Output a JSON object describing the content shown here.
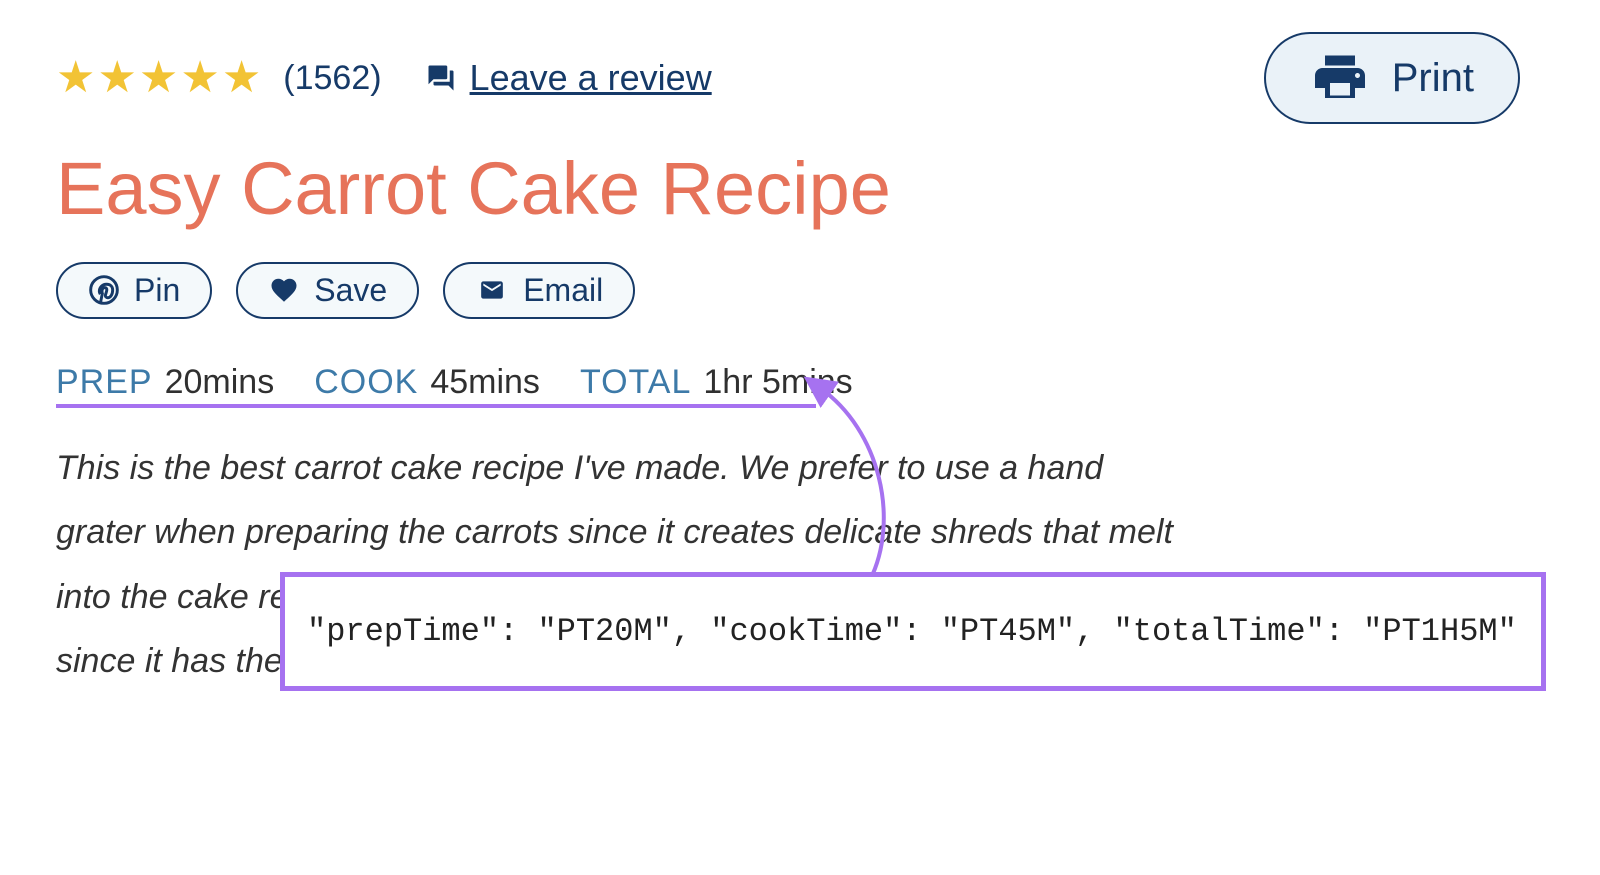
{
  "header": {
    "rating_count": "(1562)",
    "review_link": "Leave a review",
    "print_label": "Print"
  },
  "title": "Easy Carrot Cake Recipe",
  "actions": {
    "pin": "Pin",
    "save": "Save",
    "email": "Email"
  },
  "times": {
    "prep_label": "PREP",
    "prep_value": "20mins",
    "cook_label": "COOK",
    "cook_value": "45mins",
    "total_label": "TOTAL",
    "total_value": "1hr 5mins"
  },
  "description": "This is the best carrot cake recipe I've made. We prefer to use a hand grater when preparing the carrots since it creates delicate shreds that melt into the cake                                                                                                           recipe. If you only want to use one, choose brown sugar since it has the necessary acid to react with the baking soda.",
  "schema_code": "\"prepTime\": \"PT20M\", \"cookTime\": \"PT45M\", \"totalTime\": \"PT1H5M\""
}
